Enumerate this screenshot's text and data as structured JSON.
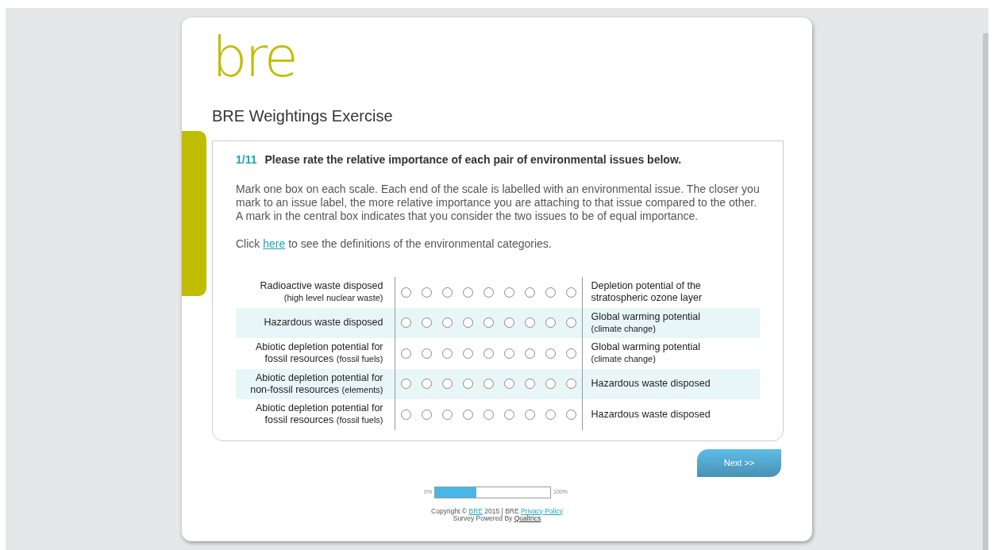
{
  "logo": "bre",
  "title": "BRE Weightings Exercise",
  "question": {
    "number": "1/11",
    "heading": "Please rate the relative importance of each pair of environmental issues below.",
    "instructions": "Mark one box on each scale. Each end of the scale is labelled with an environmental issue. The closer you mark to an issue label, the more relative importance you are attaching to that issue compared to the other. A mark in the central box indicates that you consider the two issues to be of equal importance.",
    "link_line": {
      "before": "Click",
      "link": "here",
      "after": "to see the definitions of the environmental categories."
    }
  },
  "scales": [
    {
      "left": {
        "text": "Radioactive waste disposed",
        "note": "(high level nuclear waste)",
        "note_newline": true
      },
      "right": {
        "text": "Depletion potential of the stratospheric ozone layer"
      },
      "options": [
        {
          "selected": false
        },
        {
          "selected": false
        },
        {
          "selected": false
        },
        {
          "selected": false
        },
        {
          "selected": false
        },
        {
          "selected": false
        },
        {
          "selected": false
        },
        {
          "selected": false
        },
        {
          "selected": false
        }
      ]
    },
    {
      "left": {
        "text": "Hazardous waste disposed"
      },
      "right": {
        "text": "Global warming potential",
        "note": "(climate change)",
        "note_newline": true
      },
      "options": [
        {
          "selected": false
        },
        {
          "selected": false
        },
        {
          "selected": false
        },
        {
          "selected": false
        },
        {
          "selected": false
        },
        {
          "selected": false
        },
        {
          "selected": false
        },
        {
          "selected": false
        },
        {
          "selected": false
        }
      ]
    },
    {
      "left": {
        "text": "Abiotic depletion potential for fossil resources",
        "note": "(fossil fuels)"
      },
      "right": {
        "text": "Global warming potential",
        "note": "(climate change)",
        "note_newline": true
      },
      "options": [
        {
          "selected": false
        },
        {
          "selected": false
        },
        {
          "selected": false
        },
        {
          "selected": false
        },
        {
          "selected": false
        },
        {
          "selected": false
        },
        {
          "selected": false
        },
        {
          "selected": false
        },
        {
          "selected": false
        }
      ]
    },
    {
      "left": {
        "text": "Abiotic depletion potential for non-fossil resources",
        "note": "(elements)"
      },
      "right": {
        "text": "Hazardous waste disposed"
      },
      "options": [
        {
          "selected": false
        },
        {
          "selected": false
        },
        {
          "selected": false
        },
        {
          "selected": false
        },
        {
          "selected": false
        },
        {
          "selected": false
        },
        {
          "selected": false
        },
        {
          "selected": false
        },
        {
          "selected": false
        }
      ]
    },
    {
      "left": {
        "text": "Abiotic depletion potential for fossil resources",
        "note": "(fossil fuels)"
      },
      "right": {
        "text": "Hazardous waste disposed"
      },
      "options": [
        {
          "selected": false
        },
        {
          "selected": false
        },
        {
          "selected": false
        },
        {
          "selected": false
        },
        {
          "selected": false
        },
        {
          "selected": false
        },
        {
          "selected": false
        },
        {
          "selected": false
        },
        {
          "selected": false
        }
      ]
    }
  ],
  "next_button": "Next >>",
  "progress": {
    "start": "0%",
    "end": "100%",
    "level": 0.36
  },
  "footer": {
    "copyright": "Copyright ©",
    "brand_link": "BRE",
    "year_text": "2015 | BRE",
    "policy_link": "Privacy Policy",
    "powered": "Survey Powered By",
    "powered_link": "Qualtrics"
  }
}
